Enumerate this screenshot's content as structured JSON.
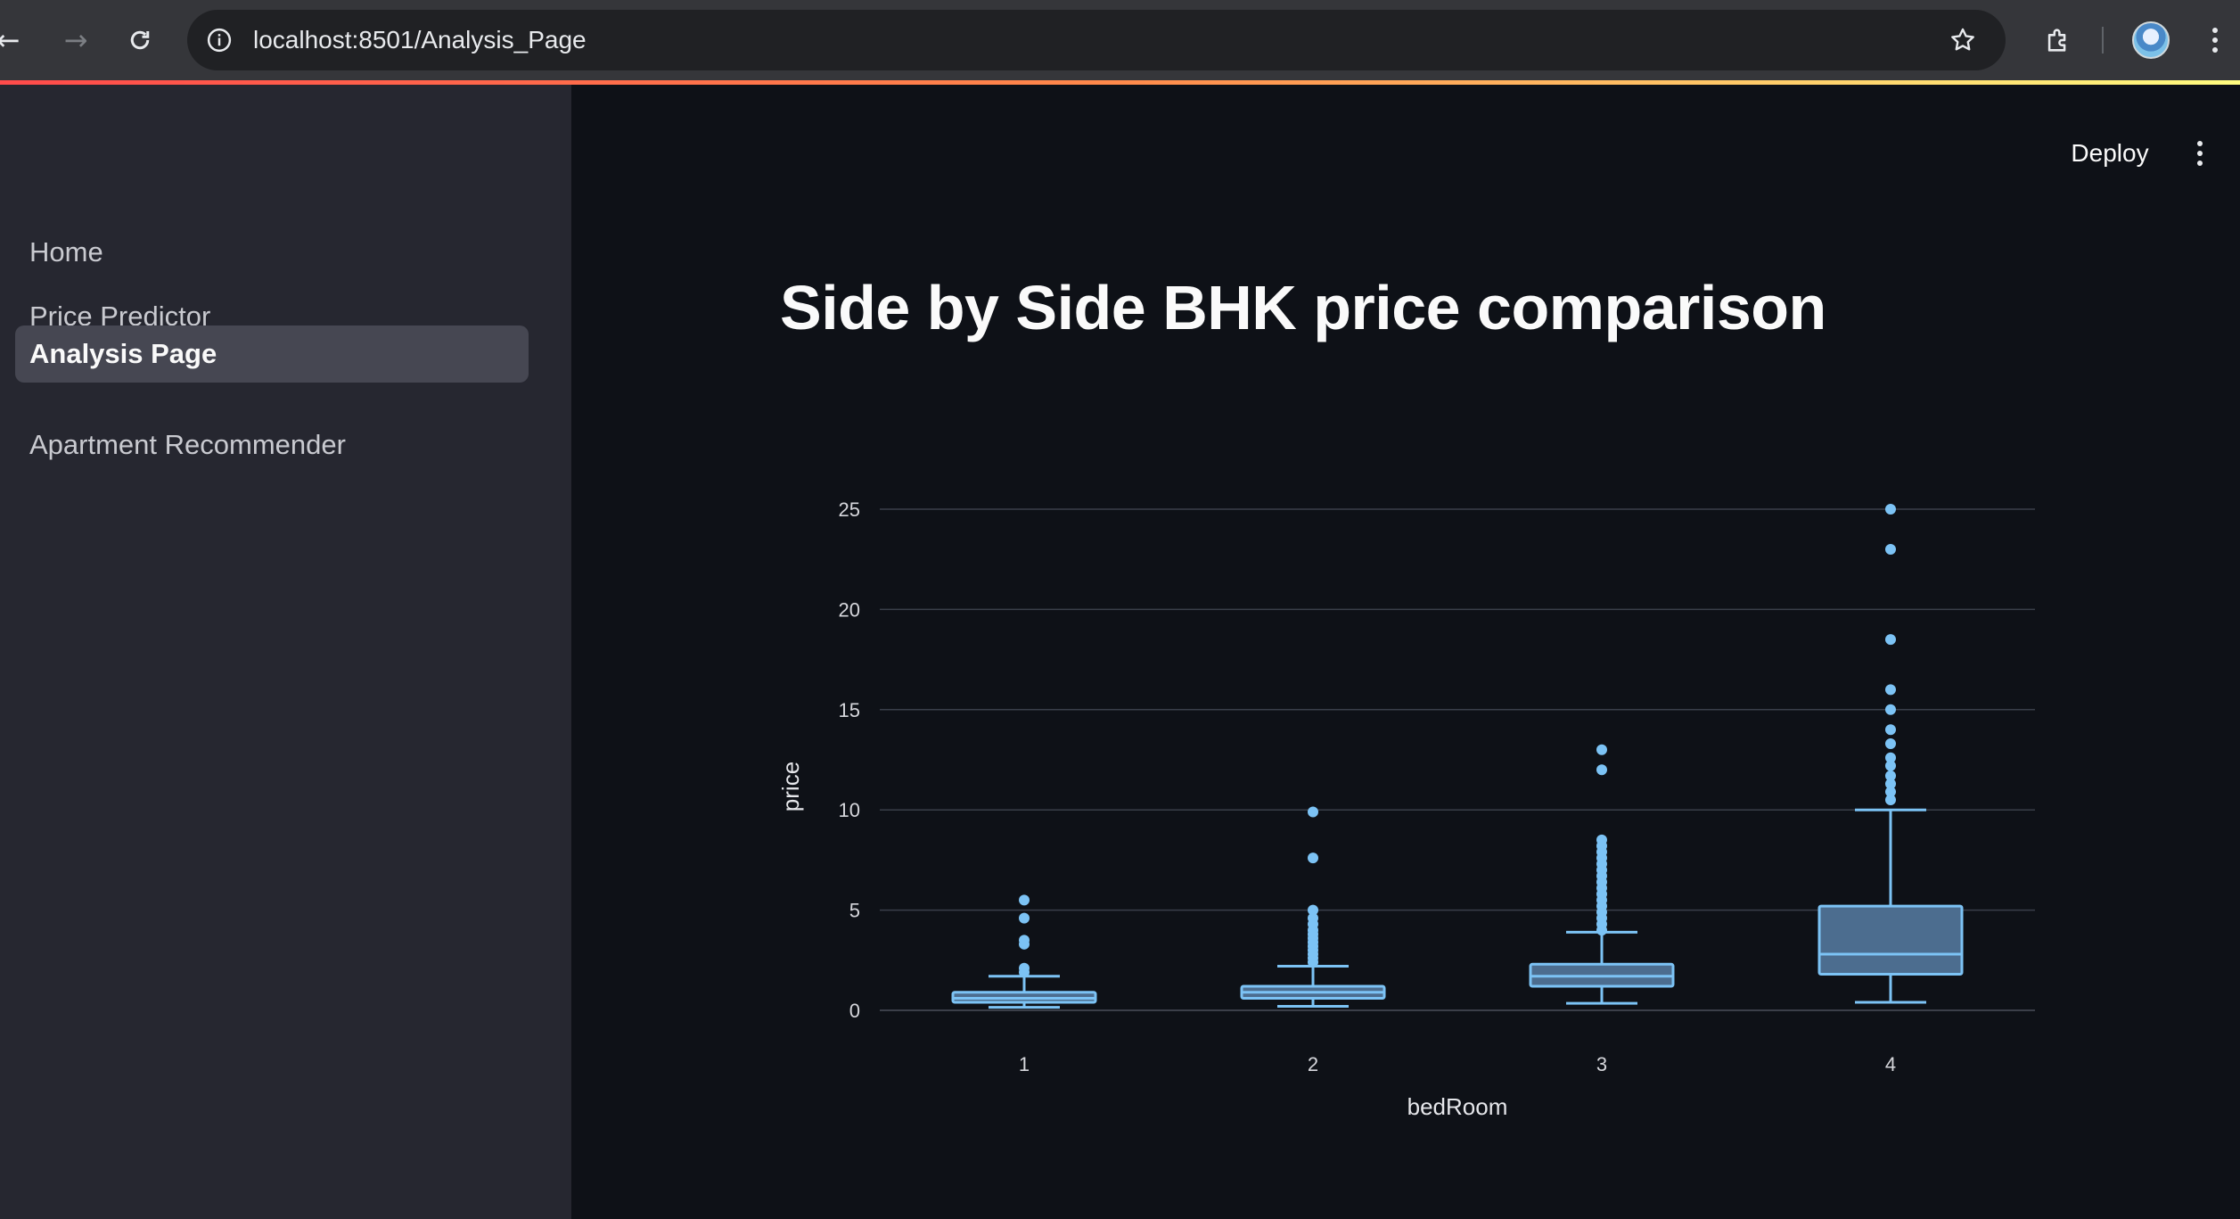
{
  "browser": {
    "url": "localhost:8501/Analysis_Page",
    "icons": [
      "back-arrow-icon",
      "forward-arrow-icon",
      "reload-icon",
      "site-info-icon",
      "bookmark-star-icon",
      "extensions-icon",
      "profile-avatar",
      "browser-menu-icon"
    ]
  },
  "sidebar": {
    "items": [
      {
        "label": "Home",
        "active": false
      },
      {
        "label": "Price Predictor",
        "active": false
      },
      {
        "label": "Analysis Page",
        "active": true
      },
      {
        "label": "Apartment Recommender",
        "active": false
      }
    ]
  },
  "toolbar": {
    "deploy_label": "Deploy",
    "menu_icon": "kebab-menu-icon"
  },
  "page": {
    "title": "Side by Side BHK price comparison"
  },
  "colors": {
    "accent_gradient": [
      "#ff4b4b",
      "#fffd80"
    ],
    "box_line": "#7cc3f5",
    "box_fill": "#4c6d8f"
  },
  "chart_data": {
    "type": "box",
    "title": "",
    "xlabel": "bedRoom",
    "ylabel": "price",
    "ylim": [
      0,
      25
    ],
    "yticks": [
      0,
      5,
      10,
      15,
      20,
      25
    ],
    "categories": [
      "1",
      "2",
      "3",
      "4"
    ],
    "grid": true,
    "boxes": [
      {
        "category": "1",
        "min": 0.15,
        "q1": 0.4,
        "median": 0.6,
        "q3": 0.9,
        "max": 1.7,
        "outliers": [
          1.9,
          2.1,
          3.3,
          3.5,
          4.6,
          5.5
        ]
      },
      {
        "category": "2",
        "min": 0.2,
        "q1": 0.6,
        "median": 0.9,
        "q3": 1.2,
        "max": 2.2,
        "outliers": [
          2.4,
          2.6,
          2.8,
          3.0,
          3.2,
          3.4,
          3.6,
          3.8,
          4.0,
          4.3,
          4.6,
          5.0,
          7.6,
          9.9
        ]
      },
      {
        "category": "3",
        "min": 0.35,
        "q1": 1.2,
        "median": 1.7,
        "q3": 2.3,
        "max": 3.9,
        "outliers": [
          4.0,
          4.3,
          4.6,
          4.9,
          5.2,
          5.5,
          5.8,
          6.1,
          6.4,
          6.7,
          7.0,
          7.3,
          7.6,
          7.9,
          8.2,
          8.5,
          12.0,
          13.0
        ]
      },
      {
        "category": "4",
        "min": 0.4,
        "q1": 1.8,
        "median": 2.8,
        "q3": 5.2,
        "max": 10.0,
        "outliers": [
          10.5,
          10.9,
          11.3,
          11.7,
          12.2,
          12.6,
          13.3,
          14.0,
          15.0,
          16.0,
          18.5,
          23.0,
          25.0
        ]
      }
    ]
  }
}
